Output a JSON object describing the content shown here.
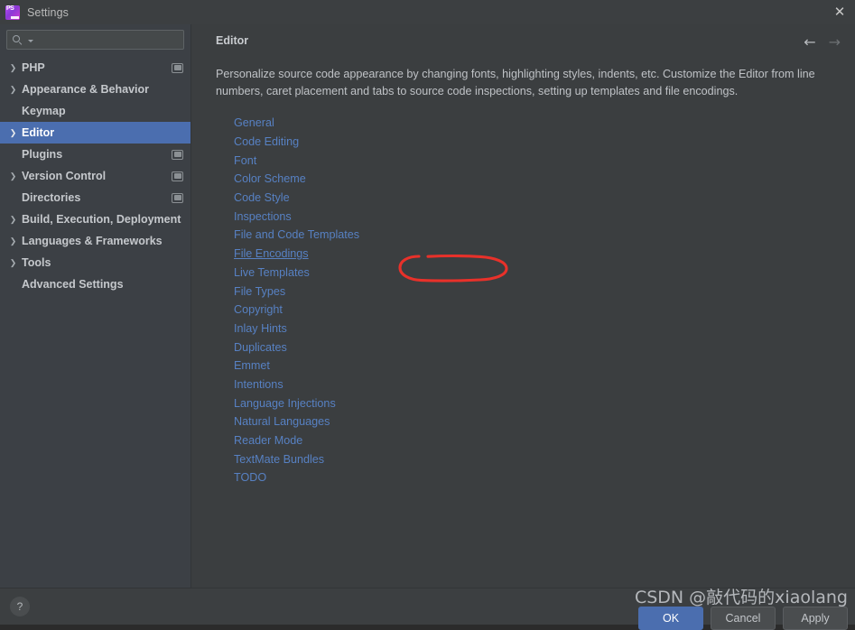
{
  "window": {
    "title": "Settings",
    "app_icon": "phpstorm-icon",
    "close_icon": "close-icon"
  },
  "search": {
    "value": "",
    "placeholder": "",
    "icon": "search-icon",
    "dropdown_icon": "chevron-down-icon"
  },
  "sidebar": {
    "items": [
      {
        "label": "PHP",
        "expandable": true,
        "selected": false,
        "scope_badge": true
      },
      {
        "label": "Appearance & Behavior",
        "expandable": true,
        "selected": false,
        "scope_badge": false
      },
      {
        "label": "Keymap",
        "expandable": false,
        "selected": false,
        "scope_badge": false
      },
      {
        "label": "Editor",
        "expandable": true,
        "selected": true,
        "scope_badge": false
      },
      {
        "label": "Plugins",
        "expandable": false,
        "selected": false,
        "scope_badge": true
      },
      {
        "label": "Version Control",
        "expandable": true,
        "selected": false,
        "scope_badge": true
      },
      {
        "label": "Directories",
        "expandable": false,
        "selected": false,
        "scope_badge": true
      },
      {
        "label": "Build, Execution, Deployment",
        "expandable": true,
        "selected": false,
        "scope_badge": false
      },
      {
        "label": "Languages & Frameworks",
        "expandable": true,
        "selected": false,
        "scope_badge": false
      },
      {
        "label": "Tools",
        "expandable": true,
        "selected": false,
        "scope_badge": false
      },
      {
        "label": "Advanced Settings",
        "expandable": false,
        "selected": false,
        "scope_badge": false
      }
    ]
  },
  "main": {
    "title": "Editor",
    "back_icon": "arrow-left-icon",
    "forward_icon": "arrow-right-icon",
    "description": "Personalize source code appearance by changing fonts, highlighting styles, indents, etc. Customize the Editor from line numbers, caret placement and tabs to source code inspections, setting up templates and file encodings.",
    "links": [
      {
        "label": "General",
        "hovered": false
      },
      {
        "label": "Code Editing",
        "hovered": false
      },
      {
        "label": "Font",
        "hovered": false
      },
      {
        "label": "Color Scheme",
        "hovered": false
      },
      {
        "label": "Code Style",
        "hovered": false
      },
      {
        "label": "Inspections",
        "hovered": false
      },
      {
        "label": "File and Code Templates",
        "hovered": false
      },
      {
        "label": "File Encodings",
        "hovered": true
      },
      {
        "label": "Live Templates",
        "hovered": false
      },
      {
        "label": "File Types",
        "hovered": false
      },
      {
        "label": "Copyright",
        "hovered": false
      },
      {
        "label": "Inlay Hints",
        "hovered": false
      },
      {
        "label": "Duplicates",
        "hovered": false
      },
      {
        "label": "Emmet",
        "hovered": false
      },
      {
        "label": "Intentions",
        "hovered": false
      },
      {
        "label": "Language Injections",
        "hovered": false
      },
      {
        "label": "Natural Languages",
        "hovered": false
      },
      {
        "label": "Reader Mode",
        "hovered": false
      },
      {
        "label": "TextMate Bundles",
        "hovered": false
      },
      {
        "label": "TODO",
        "hovered": false
      }
    ]
  },
  "annotation": {
    "shape": "hand-drawn-ellipse",
    "target": "File Encodings",
    "color": "#e8312a"
  },
  "footer": {
    "help_label": "?",
    "ok_label": "OK",
    "cancel_label": "Cancel",
    "apply_label": "Apply"
  },
  "watermark": {
    "text": "CSDN @敲代码的xiaolang"
  },
  "colors": {
    "selection": "#4b6eaf",
    "link": "#5781c3",
    "sidebar_bg": "#3c4045",
    "content_bg": "#3b3e40",
    "chrome_bg": "#3c3f41",
    "annotation_red": "#e8312a"
  }
}
